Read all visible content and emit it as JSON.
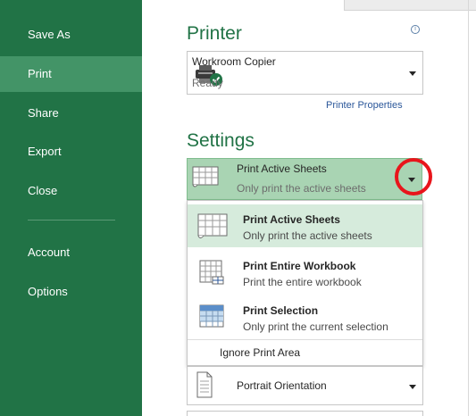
{
  "nav": {
    "items": [
      {
        "label": "Save As"
      },
      {
        "label": "Print"
      },
      {
        "label": "Share"
      },
      {
        "label": "Export"
      },
      {
        "label": "Close"
      },
      {
        "label": "Account"
      },
      {
        "label": "Options"
      }
    ],
    "active": "Print"
  },
  "printer": {
    "heading": "Printer",
    "name": "Workroom Copier",
    "status": "Ready",
    "properties_link": "Printer Properties",
    "info_glyph": "i"
  },
  "settings": {
    "heading": "Settings",
    "selected": {
      "title": "Print Active Sheets",
      "subtitle": "Only print the active sheets"
    },
    "options": [
      {
        "title": "Print Active Sheets",
        "subtitle": "Only print the active sheets",
        "icon": "sheets-icon"
      },
      {
        "title": "Print Entire Workbook",
        "subtitle": "Print the entire workbook",
        "icon": "workbook-icon"
      },
      {
        "title": "Print Selection",
        "subtitle": "Only print the current selection",
        "icon": "selection-icon"
      }
    ],
    "ignore_print_area": "Ignore Print Area",
    "orientation": "Portrait Orientation"
  },
  "colors": {
    "nav_bg": "#217346",
    "nav_active": "#439467",
    "accent_green": "#217346",
    "link_blue": "#2b579a",
    "highlight_red": "#e8151b"
  }
}
